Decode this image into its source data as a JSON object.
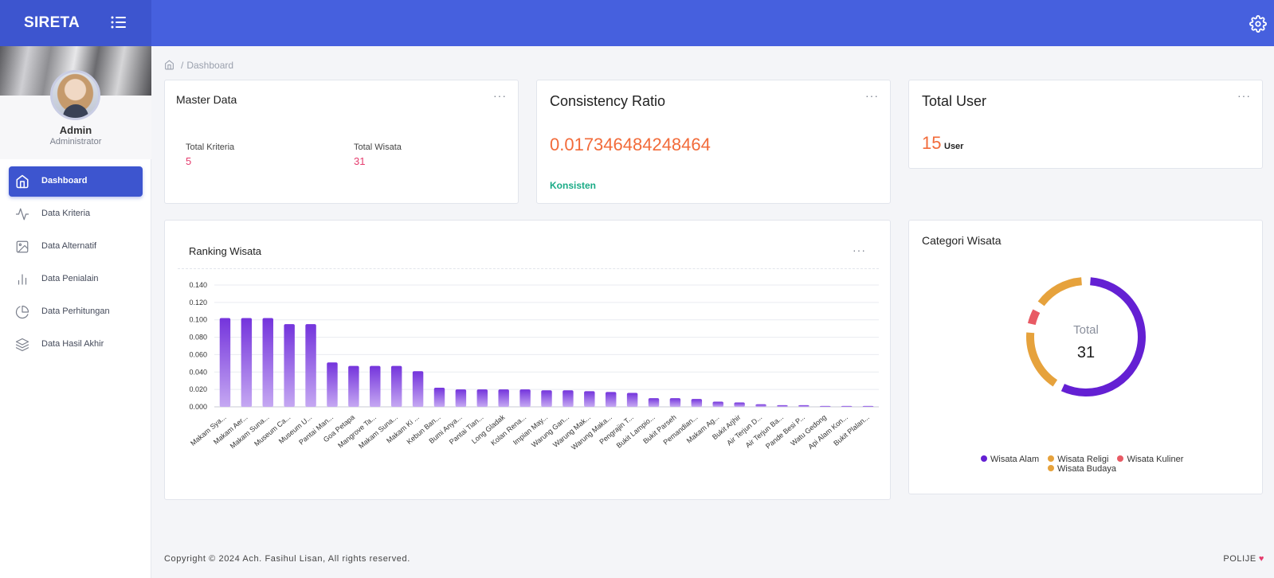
{
  "app": {
    "brand": "SIRETA"
  },
  "profile": {
    "name": "Admin",
    "role": "Administrator"
  },
  "sidebar": {
    "items": [
      {
        "label": "Dashboard",
        "icon": "home-icon",
        "active": true
      },
      {
        "label": "Data Kriteria",
        "icon": "activity-icon",
        "active": false
      },
      {
        "label": "Data Alternatif",
        "icon": "image-icon",
        "active": false
      },
      {
        "label": "Data Penialain",
        "icon": "bar-chart-icon",
        "active": false
      },
      {
        "label": "Data Perhitungan",
        "icon": "pie-chart-icon",
        "active": false
      },
      {
        "label": "Data Hasil Akhir",
        "icon": "layers-icon",
        "active": false
      }
    ]
  },
  "breadcrumb": {
    "current": "Dashboard"
  },
  "master": {
    "title": "Master Data",
    "kriteria_label": "Total Kriteria",
    "kriteria_value": "5",
    "wisata_label": "Total Wisata",
    "wisata_value": "31"
  },
  "ratio": {
    "title": "Consistency Ratio",
    "value": "0.017346484248464",
    "status": "Konsisten"
  },
  "users": {
    "title": "Total User",
    "value": "15",
    "unit": "User"
  },
  "ranking": {
    "title": "Ranking Wisata"
  },
  "category": {
    "title": "Categori Wisata"
  },
  "colors": {
    "accent": "#3d55cf",
    "topbar": "#4660de",
    "bar": "#7b3fe0",
    "alam": "#6420d3",
    "religi": "#e6a23c",
    "kuliner": "#e85a64",
    "budaya": "#e6a23c",
    "ratio": "#f26b3a",
    "success": "#1aab86",
    "pink": "#e53b6d"
  },
  "chart_data": [
    {
      "type": "bar",
      "categories": [
        "Makam Sya...",
        "Makam Aer...",
        "Makam Suna...",
        "Museum Ca...",
        "Museum U...",
        "Pantai Man...",
        "Goa Petapa",
        "Mangrove Ta...",
        "Makam Suna...",
        "Makam Ki ...",
        "Kebun Ban...",
        "Bumi Anya...",
        "Pantai Tian...",
        "Long Gladak",
        "Kolan Rena...",
        "Impian May...",
        "Warung Gan...",
        "Warung Mak...",
        "Warung Maka...",
        "Pengrajin T...",
        "Bukit Lampio...",
        "Bukit Parseh",
        "Pemandian...",
        "Makam Ag...",
        "Bukit Arjhir",
        "Air Terjun D...",
        "Air Terjun Ba...",
        "Pande Besi P...",
        "Watu Gedong",
        "Api Alam Kon...",
        "Bukit Plalan..."
      ],
      "values": [
        0.102,
        0.102,
        0.102,
        0.095,
        0.095,
        0.051,
        0.047,
        0.047,
        0.047,
        0.041,
        0.022,
        0.02,
        0.02,
        0.02,
        0.02,
        0.019,
        0.019,
        0.018,
        0.017,
        0.016,
        0.01,
        0.01,
        0.009,
        0.006,
        0.005,
        0.003,
        0.002,
        0.002,
        0.001,
        0.001,
        0.001
      ],
      "ylim": [
        0,
        0.14
      ],
      "yticks": [
        "0.000",
        "0.020",
        "0.040",
        "0.060",
        "0.080",
        "0.100",
        "0.120",
        "0.140"
      ],
      "grid": true
    },
    {
      "type": "pie",
      "center_label": "Total",
      "center_value": "31",
      "series": [
        {
          "name": "Wisata Alam",
          "value": 18,
          "color": "#6420d3"
        },
        {
          "name": "Wisata Religi",
          "value": 6,
          "color": "#e6a23c"
        },
        {
          "name": "Wisata Kuliner",
          "value": 2,
          "color": "#e85a64"
        },
        {
          "name": "Wisata Budaya",
          "value": 5,
          "color": "#e6a23c"
        }
      ],
      "legend_position": "bottom"
    }
  ],
  "footer": {
    "copyright": "Copyright © 2024 Ach. Fasihul Lisan, All rights reserved.",
    "org": "POLIJE"
  }
}
